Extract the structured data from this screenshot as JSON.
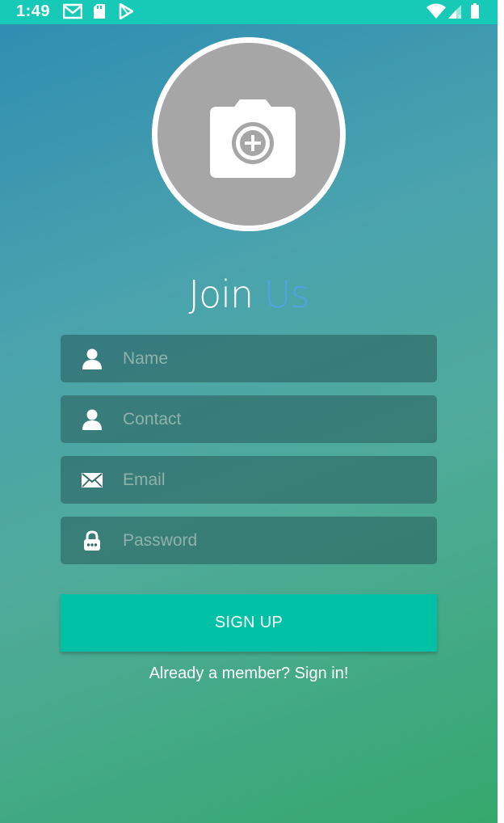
{
  "status_bar": {
    "time": "1:49",
    "icons": [
      "gmail-icon",
      "sd-card-icon",
      "play-store-icon",
      "wifi-icon",
      "signal-icon",
      "battery-icon"
    ]
  },
  "avatar": {
    "icon": "camera-add-icon"
  },
  "title": {
    "part1": "Join",
    "part2": "Us"
  },
  "form": {
    "name": {
      "placeholder": "Name",
      "icon": "person-icon"
    },
    "contact": {
      "placeholder": "Contact",
      "icon": "person-icon"
    },
    "email": {
      "placeholder": "Email",
      "icon": "envelope-icon"
    },
    "password": {
      "placeholder": "Password",
      "icon": "lock-icon"
    }
  },
  "actions": {
    "signup_label": "SIGN UP",
    "signin_text": "Already a member? Sign in!"
  },
  "colors": {
    "status_bar": "#17cab7",
    "button": "#00c1a6",
    "title_accent": "#4fa3e6"
  }
}
